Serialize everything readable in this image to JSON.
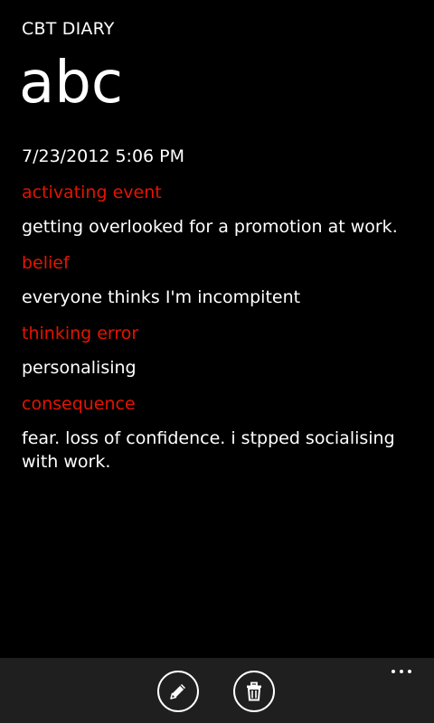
{
  "app": {
    "title": "CBT DIARY",
    "page_title": "abc"
  },
  "entry": {
    "datetime": "7/23/2012 5:06 PM",
    "fields": [
      {
        "label": "activating event",
        "value": "getting overlooked for a promotion at work."
      },
      {
        "label": "belief",
        "value": "everyone thinks I'm incompitent"
      },
      {
        "label": "thinking error",
        "value": "personalising"
      },
      {
        "label": "consequence",
        "value": "fear. loss of confidence. i stpped socialising with work."
      }
    ]
  },
  "appbar": {
    "buttons": [
      {
        "icon": "edit-icon"
      },
      {
        "icon": "delete-icon"
      }
    ],
    "more_icon": "ellipsis-icon"
  },
  "colors": {
    "accent": "#e51400",
    "background": "#000000",
    "appbar": "#1f1f1f",
    "text": "#ffffff"
  }
}
